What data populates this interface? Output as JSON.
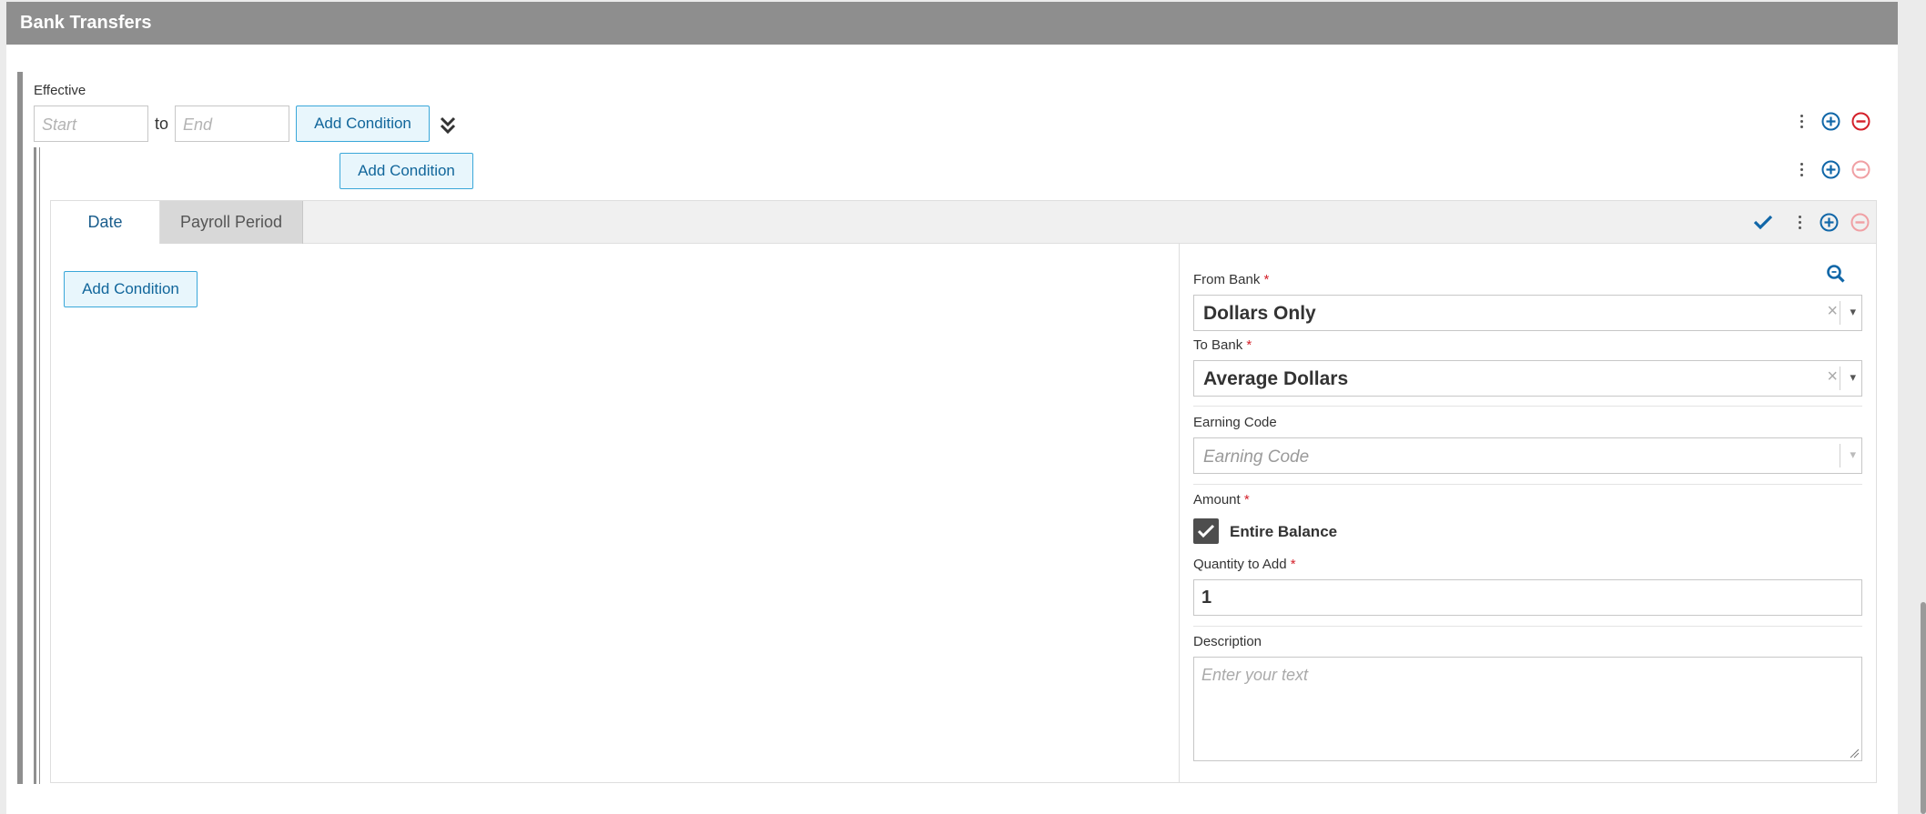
{
  "panel": {
    "title": "Bank Transfers"
  },
  "effective": {
    "label": "Effective",
    "start_placeholder": "Start",
    "to_label": "to",
    "end_placeholder": "End",
    "add_condition_label": "Add Condition"
  },
  "nested": {
    "add_condition_label": "Add Condition"
  },
  "tabs": [
    {
      "label": "Date",
      "active": true
    },
    {
      "label": "Payroll Period",
      "active": false
    }
  ],
  "left_pane": {
    "add_condition_label": "Add Condition"
  },
  "form": {
    "from_bank": {
      "label": "From Bank",
      "required_mark": "*",
      "value": "Dollars Only"
    },
    "to_bank": {
      "label": "To Bank",
      "required_mark": "*",
      "value": "Average Dollars"
    },
    "earning_code": {
      "label": "Earning Code",
      "placeholder": "Earning Code"
    },
    "amount": {
      "label": "Amount",
      "required_mark": "*",
      "checkbox_label": "Entire Balance",
      "checked": true
    },
    "quantity": {
      "label": "Quantity to Add",
      "required_mark": "*",
      "value": "1"
    },
    "description": {
      "label": "Description",
      "placeholder": "Enter your text"
    }
  },
  "colors": {
    "header_bg": "#8e8e8e",
    "button_border": "#3aa7d9",
    "button_text": "#11669b",
    "add_icon": "#1167a8",
    "remove_icon_active": "#d4202a",
    "remove_icon_disabled": "#f0a0a4",
    "check_icon": "#1167a8"
  },
  "icons": {
    "clear": "×",
    "caret": "▾"
  }
}
